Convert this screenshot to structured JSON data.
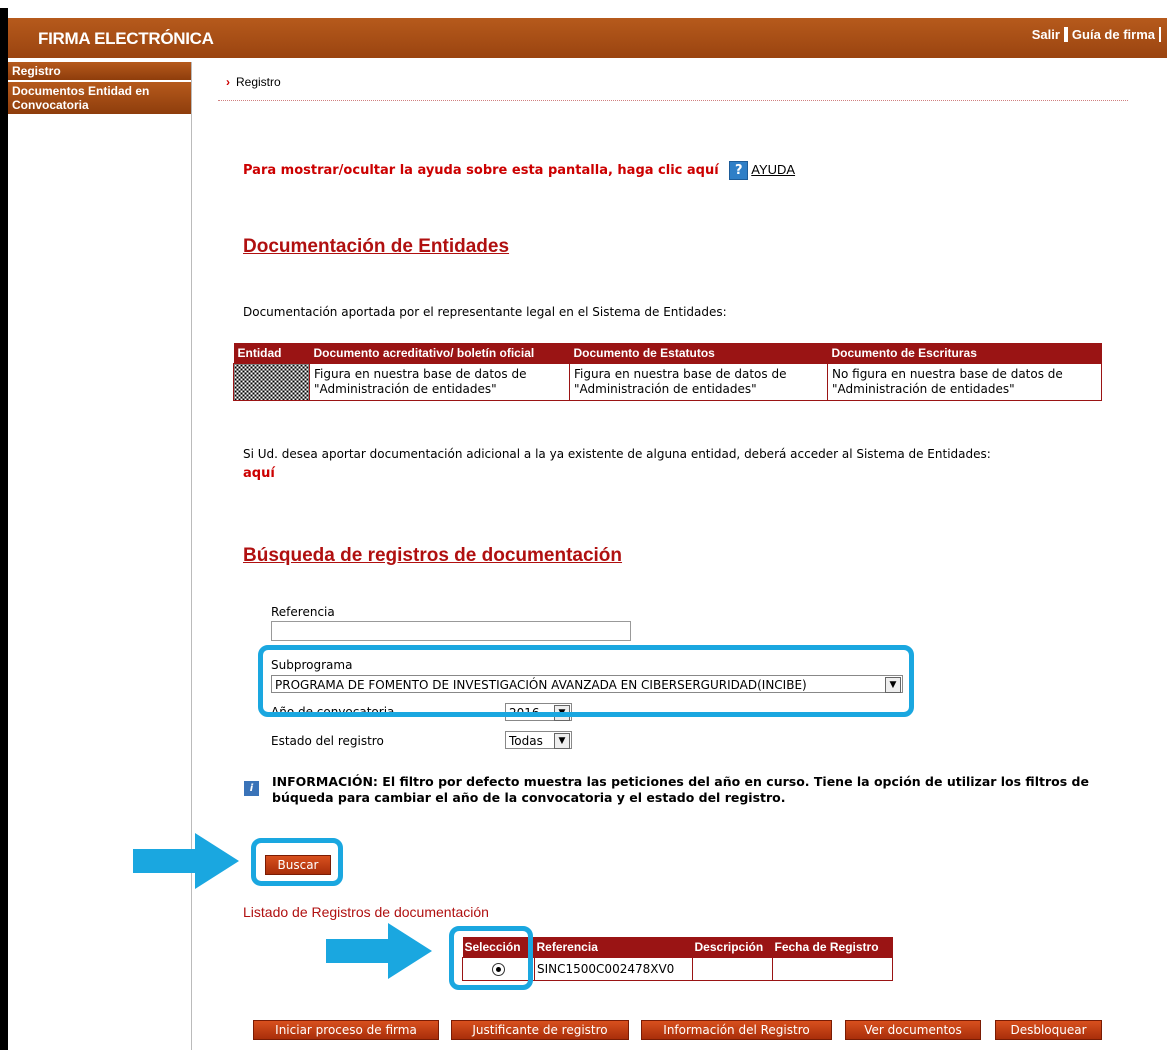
{
  "header": {
    "title": "FIRMA ELECTRÓNICA",
    "links": [
      "Salir",
      "Guía de firma"
    ]
  },
  "sidebar": {
    "items": [
      "Registro",
      "Documentos Entidad en Convocatoria"
    ]
  },
  "breadcrumb": "Registro",
  "help": {
    "text": "Para mostrar/ocultar la ayuda sobre esta pantalla, haga clic aquí",
    "icon": "question-icon",
    "link": "AYUDA"
  },
  "entities": {
    "title": "Documentación de Entidades",
    "intro": "Documentación aportada por el representante legal en el Sistema de Entidades:",
    "columns": [
      "Entidad",
      "Documento acreditativo/ boletín oficial",
      "Documento de Estatutos",
      "Documento de Escrituras"
    ],
    "row": [
      "Figura en nuestra base de datos de \"Administración de entidades\"",
      "Figura en nuestra base de datos de \"Administración de entidades\"",
      "No figura en nuestra base de datos de \"Administración de entidades\""
    ],
    "additional": "Si Ud. desea aportar documentación adicional a la ya existente de alguna entidad, deberá acceder al Sistema de Entidades:",
    "aqui": "aquí"
  },
  "search": {
    "title": "Búsqueda de registros de documentación",
    "referencia_label": "Referencia",
    "referencia_value": "",
    "subprograma_label": "Subprograma",
    "subprograma_value": "PROGRAMA DE FOMENTO DE INVESTIGACIÓN AVANZADA EN CIBERSERGURIDAD(INCIBE)",
    "anio_label": "Año de convocatoria",
    "anio_value": "2016",
    "estado_label": "Estado del registro",
    "estado_value": "Todas",
    "info": "INFORMACIÓN: El filtro por defecto muestra las peticiones del año en curso. Tiene la opción de utilizar los filtros de búqueda para cambiar el año de la convocatoria y el estado del registro.",
    "buscar": "Buscar"
  },
  "results": {
    "title": "Listado de Registros de documentación",
    "columns": [
      "Selección",
      "Referencia",
      "Descripción",
      "Fecha de Registro"
    ],
    "rows": [
      {
        "referencia": "SINC1500C002478XV0",
        "descripcion": "",
        "fecha": ""
      }
    ]
  },
  "actions": [
    "Iniciar proceso de firma",
    "Justificante de registro",
    "Información del Registro",
    "Ver documentos",
    "Desbloquear"
  ],
  "colors": {
    "header": "#9a4410",
    "table_header": "#9a1414",
    "highlight": "#1aa7e0",
    "heading": "#b01010"
  }
}
